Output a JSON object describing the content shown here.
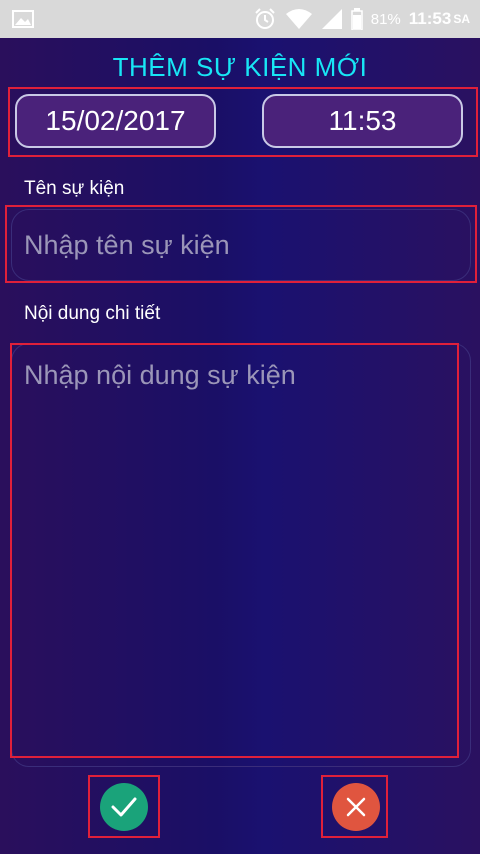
{
  "status_bar": {
    "battery_percent": "81%",
    "time": "11:53",
    "period": "SA",
    "icons": [
      "image-icon",
      "alarm-icon",
      "wifi-icon",
      "signal-icon",
      "battery-icon"
    ]
  },
  "header": {
    "title": "THÊM SỰ KIỆN MỚI"
  },
  "datetime": {
    "date": "15/02/2017",
    "time": "11:53"
  },
  "event_name": {
    "label": "Tên sự kiện",
    "placeholder": "Nhập tên sự kiện"
  },
  "event_detail": {
    "label": "Nội dung chi tiết",
    "placeholder": "Nhập nội dung sự kiện"
  },
  "actions": {
    "confirm_icon": "check-icon",
    "cancel_icon": "close-icon",
    "confirm_color": "#1aa37a",
    "cancel_color": "#e0553f"
  },
  "colors": {
    "accent": "#18e6f5",
    "highlight_box": "#e0203a"
  }
}
